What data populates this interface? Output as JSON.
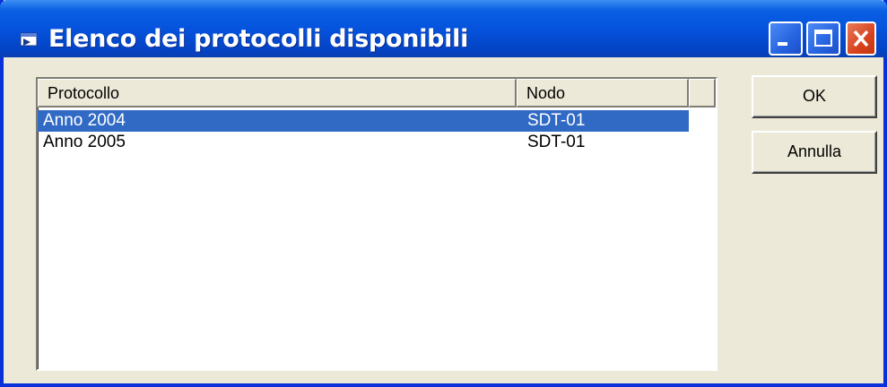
{
  "window": {
    "title": "Elenco dei protocolli disponibili",
    "controls": [
      "minimize-icon",
      "maximize-icon",
      "close-icon"
    ]
  },
  "list": {
    "columns": [
      "Protocollo",
      "Nodo"
    ],
    "rows": [
      {
        "protocollo": "Anno 2004",
        "nodo": "SDT-01",
        "selected": true
      },
      {
        "protocollo": "Anno 2005",
        "nodo": "SDT-01",
        "selected": false
      }
    ]
  },
  "buttons": {
    "ok": "OK",
    "cancel": "Annulla"
  },
  "colors": {
    "titlebar": "#0553dd",
    "selection": "#316ac5",
    "dialog_bg": "#ece9d8",
    "close_button": "#d8431e"
  }
}
